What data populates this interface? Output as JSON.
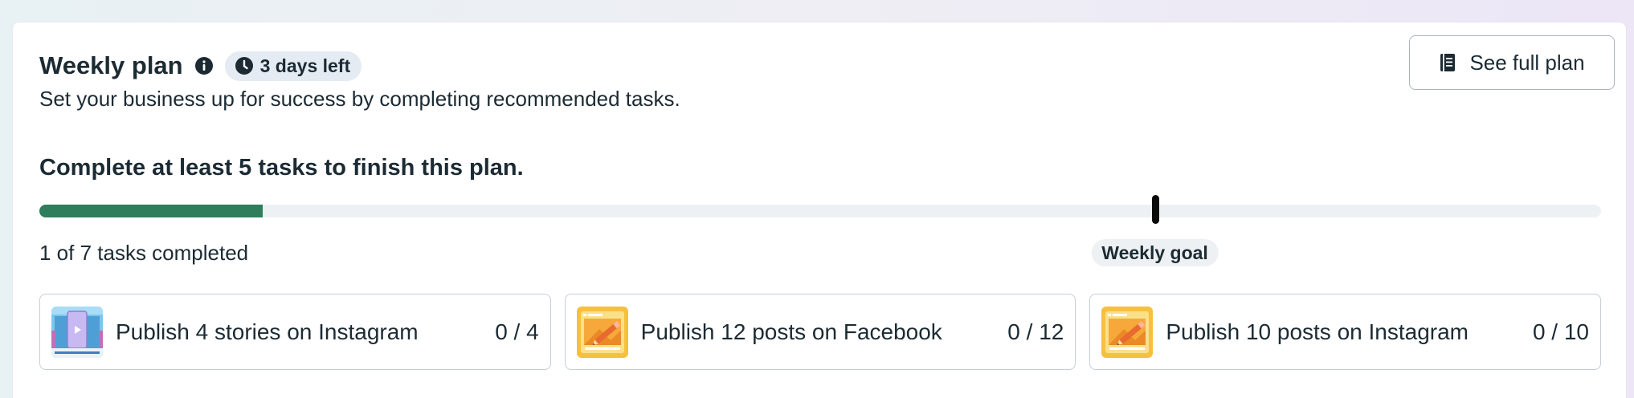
{
  "header": {
    "title": "Weekly plan",
    "days_left": "3 days left",
    "subtitle": "Set your business up for success by completing recommended tasks.",
    "see_full_plan_label": "See full plan"
  },
  "progress": {
    "heading": "Complete at least 5 tasks to finish this plan.",
    "completed_label": "1 of 7 tasks completed",
    "completed": 1,
    "total": 7,
    "goal": 5,
    "goal_label": "Weekly goal",
    "fill_color": "#2f7d5b"
  },
  "tasks": [
    {
      "label": "Publish 4 stories on Instagram",
      "count": "0 / 4",
      "icon": "instagram-story-thumbnail-icon"
    },
    {
      "label": "Publish 12 posts on Facebook",
      "count": "0 / 12",
      "icon": "post-composer-thumbnail-icon"
    },
    {
      "label": "Publish 10 posts on Instagram",
      "count": "0 / 10",
      "icon": "post-composer-thumbnail-icon"
    }
  ]
}
